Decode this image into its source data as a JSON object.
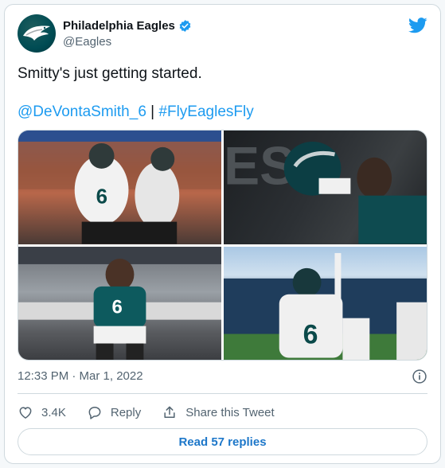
{
  "account": {
    "display_name": "Philadelphia Eagles",
    "handle": "@Eagles",
    "verified": true
  },
  "tweet": {
    "text": "Smitty's just getting started.",
    "mention": "@DeVontaSmith_6",
    "separator": "|",
    "hashtag": "#FlyEaglesFly"
  },
  "media": {
    "count": 4
  },
  "meta": {
    "timestamp": "12:33 PM · Mar 1, 2022"
  },
  "actions": {
    "likes": "3.4K",
    "reply_label": "Reply",
    "share_label": "Share this Tweet"
  },
  "replies_button": "Read 57 replies",
  "colors": {
    "twitter_blue": "#1d9bf0",
    "eagles_green": "#004c54",
    "secondary_text": "#536471"
  },
  "icons": [
    "twitter-bird-icon",
    "verified-badge-icon",
    "info-icon",
    "heart-icon",
    "reply-icon",
    "share-icon"
  ]
}
